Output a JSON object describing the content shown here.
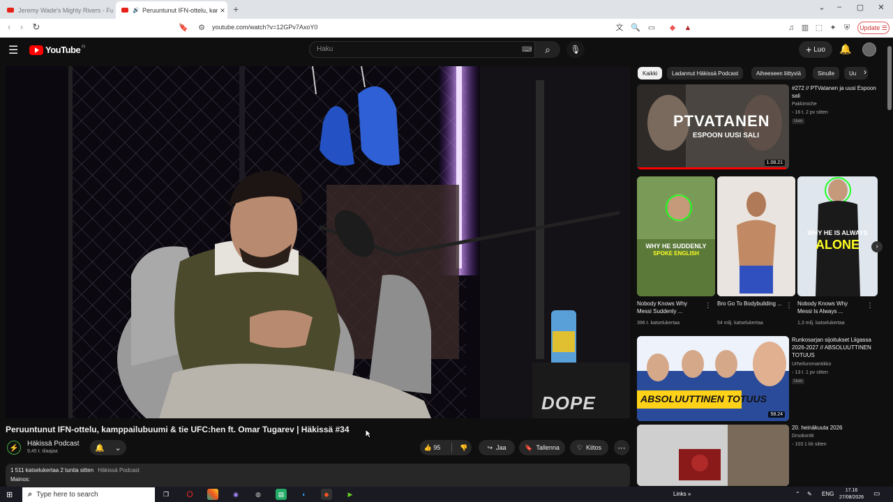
{
  "browser": {
    "tabs": [
      {
        "label": "Jeremy Wade's Mighty Rivers - Full E",
        "active": false
      },
      {
        "label": "Peruuntunut IFN-ottelu, kamp",
        "active": true
      }
    ],
    "url": "youtube.com/watch?v=12GPv7AxoY0",
    "update_label": "Update"
  },
  "header": {
    "logo_text": "YouTube",
    "country": "FI",
    "search_placeholder": "Haku",
    "create_label": "Luo"
  },
  "video": {
    "title": "Peruuntunut IFN-ottelu, kamppailubuumi & tie UFC:hen ft. Omar Tugarev | Häkissä #34",
    "channel": "Häkissä Podcast",
    "subscribers": "9,45 t. tilaajaa",
    "likes": "95",
    "share_label": "Jaa",
    "save_label": "Tallenna",
    "thanks_label": "Kiitos",
    "overlay_text": "DOPE DRINK",
    "description": {
      "stats": "1 511 katselukertaa  2 tuntia sitten",
      "channel_link": "Häkissä Podcast",
      "text": "Mainos:"
    }
  },
  "chips": [
    {
      "label": "Kaikki",
      "active": true
    },
    {
      "label": "Ladannut Häkissä Podcast",
      "active": false
    },
    {
      "label": "Aiheeseen liittyviä",
      "active": false
    },
    {
      "label": "Sinulle",
      "active": false
    },
    {
      "label": "Uu",
      "active": false
    }
  ],
  "recommendations": [
    {
      "title": "#272 // PTVatanen ja uusi Espoon sali",
      "channel": "Pakkimiche",
      "meta": "16 t.  2 pv sitten",
      "badge": "Uusi",
      "duration": "1.08.21",
      "thumb_text": "PTVATANEN",
      "thumb_sub": "ESPOON UUSI SALI",
      "progress": 0.98
    },
    {
      "title": "Runkosarjan sijoitukset Liigassa 2026-2027 // ABSOLUUTTINEN TOTUUS",
      "channel": "Urheiluromantikko",
      "meta": "13 t.  1 pv sitten",
      "badge": "Uusi",
      "duration": "58.24",
      "thumb_text": "ABSOLUUTTINEN TOTUUS"
    },
    {
      "title": "20. heinäkuuta 2026",
      "channel": "Drsokontti",
      "meta": "103  1 kk sitten"
    }
  ],
  "shorts": [
    {
      "title": "Nobody Knows Why Messi Suddenly ...",
      "views": "396 t. katselukertaa",
      "thumb_text": "WHY HE SUDDENLY",
      "thumb_sub": "SPOKE ENGLISH"
    },
    {
      "title": "Bro Go To Bodybuilding ...",
      "views": "54 milj. katselukertaa"
    },
    {
      "title": "Nobody Knows Why Messi Is Always ...",
      "views": "1,3 milj. katselukertaa",
      "thumb_text": "WHY HE IS ALWAYS",
      "thumb_sub": "ALONE"
    }
  ],
  "taskbar": {
    "search_placeholder": "Type here to search",
    "links_label": "Links",
    "lang": "ENG",
    "time": "17.16",
    "date": "27/08/2026"
  }
}
